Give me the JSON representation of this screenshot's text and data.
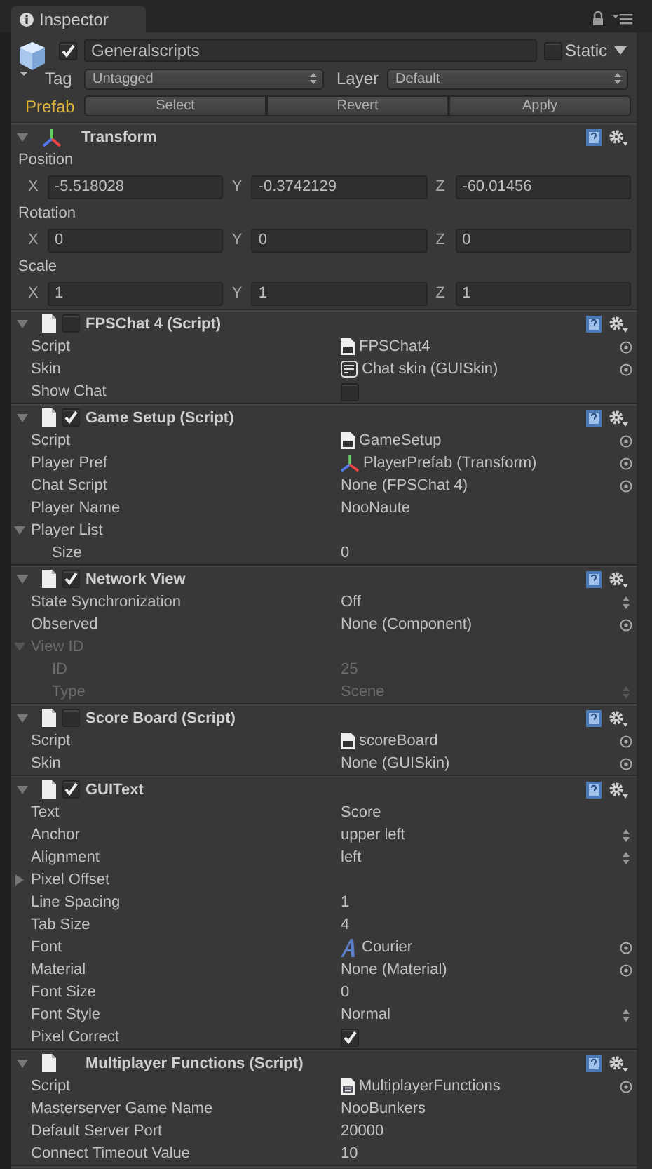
{
  "tab": {
    "label": "Inspector"
  },
  "object": {
    "active": true,
    "name": "Generalscripts",
    "static_label": "Static",
    "static": false,
    "tag_label": "Tag",
    "tag": "Untagged",
    "layer_label": "Layer",
    "layer": "Default",
    "prefab_label": "Prefab",
    "prefab_buttons": [
      "Select",
      "Revert",
      "Apply"
    ]
  },
  "transform": {
    "title": "Transform",
    "expanded": true,
    "vectors": [
      {
        "label": "Position",
        "fields": [
          {
            "axis": "X",
            "value": "-5.518028"
          },
          {
            "axis": "Y",
            "value": "-0.3742129"
          },
          {
            "axis": "Z",
            "value": "-60.01456"
          }
        ]
      },
      {
        "label": "Rotation",
        "fields": [
          {
            "axis": "X",
            "value": "0"
          },
          {
            "axis": "Y",
            "value": "0"
          },
          {
            "axis": "Z",
            "value": "0"
          }
        ]
      },
      {
        "label": "Scale",
        "fields": [
          {
            "axis": "X",
            "value": "1"
          },
          {
            "axis": "Y",
            "value": "1"
          },
          {
            "axis": "Z",
            "value": "1"
          }
        ]
      }
    ]
  },
  "components": [
    {
      "title": "FPSChat 4 (Script)",
      "expanded": true,
      "enabled": false,
      "properties": [
        {
          "kind": "object",
          "label": "Script",
          "value": "FPSChat4",
          "asset": {
            "kind": "js"
          }
        },
        {
          "kind": "object",
          "label": "Skin",
          "value": "Chat skin (GUISkin)",
          "asset": {
            "kind": "skin"
          }
        },
        {
          "kind": "checkbox",
          "label": "Show Chat",
          "checked": false
        }
      ]
    },
    {
      "title": "Game Setup (Script)",
      "expanded": true,
      "enabled": true,
      "properties": [
        {
          "kind": "object",
          "label": "Script",
          "value": "GameSetup",
          "asset": {
            "kind": "js"
          }
        },
        {
          "kind": "object",
          "label": "Player Pref",
          "value": "PlayerPrefab (Transform)",
          "asset": {
            "kind": "transform"
          }
        },
        {
          "kind": "object",
          "label": "Chat Script",
          "value": "None (FPSChat 4)"
        },
        {
          "kind": "text",
          "label": "Player Name",
          "value": "NooNaute"
        },
        {
          "kind": "foldout",
          "label": "Player List",
          "expanded": true,
          "children": [
            {
              "kind": "text",
              "label": "Size",
              "value": "0"
            }
          ]
        }
      ]
    },
    {
      "title": "Network View",
      "expanded": true,
      "enabled": true,
      "properties": [
        {
          "kind": "dropdown",
          "label": "State Synchronization",
          "value": "Off"
        },
        {
          "kind": "object",
          "label": "Observed",
          "value": "None (Component)"
        },
        {
          "kind": "foldout",
          "label": "View ID",
          "expanded": true,
          "disabled": true,
          "children": [
            {
              "kind": "text",
              "label": "ID",
              "value": "25",
              "disabled": true
            },
            {
              "kind": "dropdown",
              "label": "Type",
              "value": "Scene",
              "disabled": true
            }
          ]
        }
      ]
    },
    {
      "title": "Score Board (Script)",
      "expanded": true,
      "enabled": false,
      "properties": [
        {
          "kind": "object",
          "label": "Script",
          "value": "scoreBoard",
          "asset": {
            "kind": "js"
          }
        },
        {
          "kind": "object",
          "label": "Skin",
          "value": "None (GUISkin)"
        }
      ]
    },
    {
      "title": "GUIText",
      "expanded": true,
      "enabled": true,
      "properties": [
        {
          "kind": "text",
          "label": "Text",
          "value": "Score"
        },
        {
          "kind": "dropdown",
          "label": "Anchor",
          "value": "upper left"
        },
        {
          "kind": "dropdown",
          "label": "Alignment",
          "value": "left"
        },
        {
          "kind": "foldout",
          "label": "Pixel Offset",
          "expanded": false
        },
        {
          "kind": "text",
          "label": "Line Spacing",
          "value": "1"
        },
        {
          "kind": "text",
          "label": "Tab Size",
          "value": "4"
        },
        {
          "kind": "object",
          "label": "Font",
          "value": "Courier",
          "asset": {
            "kind": "font"
          }
        },
        {
          "kind": "object",
          "label": "Material",
          "value": "None (Material)"
        },
        {
          "kind": "text",
          "label": "Font Size",
          "value": "0"
        },
        {
          "kind": "dropdown",
          "label": "Font Style",
          "value": "Normal"
        },
        {
          "kind": "checkbox",
          "label": "Pixel Correct",
          "checked": true
        }
      ]
    },
    {
      "title": "Multiplayer Functions (Script)",
      "expanded": true,
      "properties": [
        {
          "kind": "object",
          "label": "Script",
          "value": "MultiplayerFunctions",
          "asset": {
            "kind": "cs"
          }
        },
        {
          "kind": "text",
          "label": "Masterserver Game Name",
          "value": "NooBunkers"
        },
        {
          "kind": "text",
          "label": "Default Server Port",
          "value": "20000"
        },
        {
          "kind": "text",
          "label": "Connect Timeout Value",
          "value": "10"
        }
      ]
    }
  ]
}
